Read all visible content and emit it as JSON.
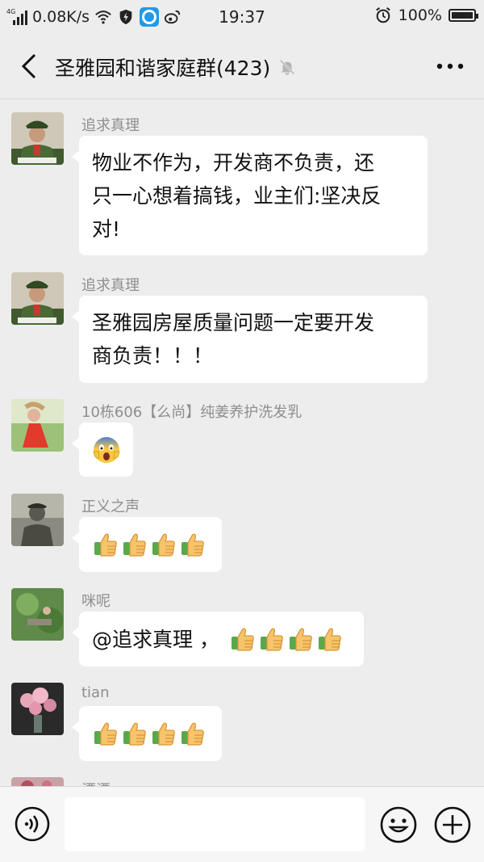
{
  "status_bar": {
    "network_label": "4G",
    "speed": "0.08K/s",
    "time": "19:37",
    "battery": "100%",
    "battery_level": 1.0
  },
  "nav": {
    "title": "圣雅园和谐家庭群(423)",
    "back_icon": "chevron-left-icon",
    "mute_icon": "muted-bell-icon",
    "more_icon": "more-icon"
  },
  "messages": [
    {
      "sender": "追求真理",
      "text": "物业不作为，开发商不负责，还\n只一心想着搞钱，业主们:坚决反\n对!"
    },
    {
      "sender": "追求真理",
      "text": "圣雅园房屋质量问题一定要开发\n商负责！！！"
    },
    {
      "sender": "10栋606【么尚】纯姜养护洗发乳",
      "emoji": "screaming-face-emoji"
    },
    {
      "sender": "正义之声",
      "emoji": "thumbs-up-emoji",
      "count": 4
    },
    {
      "sender": "咪呢",
      "text": "@追求真理 ，",
      "emoji": "thumbs-up-emoji",
      "count": 4
    },
    {
      "sender": "tian",
      "emoji": "thumbs-up-emoji",
      "count": 4
    },
    {
      "sender": "漂漂"
    }
  ],
  "input_bar": {
    "voice_icon": "voice-icon",
    "emoji_icon": "smiley-icon",
    "plus_icon": "plus-icon",
    "placeholder": ""
  },
  "colors": {
    "background": "#ededed",
    "bubble": "#ffffff",
    "sender_name": "#8e8e8e",
    "accent_blue": "#1e9be8"
  }
}
